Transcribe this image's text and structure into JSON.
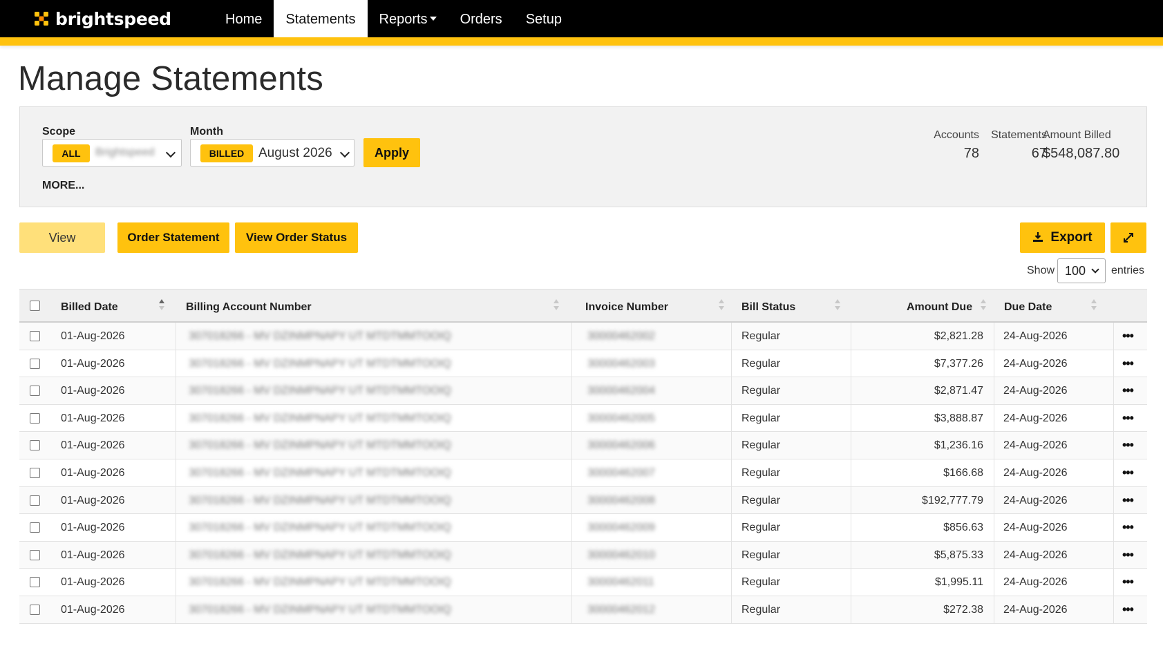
{
  "brand": {
    "name": "brightspeed",
    "accent": "#ffc20e"
  },
  "nav": {
    "items": [
      {
        "label": "Home",
        "active": false
      },
      {
        "label": "Statements",
        "active": true
      },
      {
        "label": "Reports",
        "active": false,
        "dropdown": true
      },
      {
        "label": "Orders",
        "active": false
      },
      {
        "label": "Setup",
        "active": false
      }
    ]
  },
  "page": {
    "title": "Manage Statements"
  },
  "filters": {
    "scope": {
      "label": "Scope",
      "pill": "ALL",
      "value": "Brightspeed"
    },
    "month": {
      "label": "Month",
      "pill": "BILLED",
      "value": "August 2026"
    },
    "apply_label": "Apply",
    "more_label": "MORE..."
  },
  "summary": {
    "accounts": {
      "label": "Accounts",
      "value": "78"
    },
    "statements": {
      "label": "Statements",
      "value": "67"
    },
    "amount_billed": {
      "label": "Amount Billed",
      "value": "$548,087.80"
    }
  },
  "actions": {
    "view_label": "View",
    "order_statement_label": "Order Statement",
    "view_order_status_label": "View Order Status",
    "export_label": "Export",
    "export_icon": "download-icon",
    "expand_icon": "expand-icon"
  },
  "pagination": {
    "show_label": "Show",
    "page_size": "100",
    "entries_label": "entries"
  },
  "table": {
    "columns": [
      "Billed Date",
      "Billing Account Number",
      "Invoice Number",
      "Bill Status",
      "Amount Due",
      "Due Date"
    ],
    "rows": [
      {
        "billed_date": "01-Aug-2026",
        "account": "307018266 - MV DZINMPNAPY UT MTDTMMTOOIQ",
        "invoice": "30000462002",
        "status": "Regular",
        "amount": "$2,821.28",
        "due_date": "24-Aug-2026"
      },
      {
        "billed_date": "01-Aug-2026",
        "account": "307018266 - MV DZINMPNAPY UT MTDTMMTOOIQ",
        "invoice": "30000462003",
        "status": "Regular",
        "amount": "$7,377.26",
        "due_date": "24-Aug-2026"
      },
      {
        "billed_date": "01-Aug-2026",
        "account": "307018266 - MV DZINMPNAPY UT MTDTMMTOOIQ",
        "invoice": "30000462004",
        "status": "Regular",
        "amount": "$2,871.47",
        "due_date": "24-Aug-2026"
      },
      {
        "billed_date": "01-Aug-2026",
        "account": "307018266 - MV DZINMPNAPY UT MTDTMMTOOIQ",
        "invoice": "30000462005",
        "status": "Regular",
        "amount": "$3,888.87",
        "due_date": "24-Aug-2026"
      },
      {
        "billed_date": "01-Aug-2026",
        "account": "307018266 - MV DZINMPNAPY UT MTDTMMTOOIQ",
        "invoice": "30000462006",
        "status": "Regular",
        "amount": "$1,236.16",
        "due_date": "24-Aug-2026"
      },
      {
        "billed_date": "01-Aug-2026",
        "account": "307018266 - MV DZINMPNAPY UT MTDTMMTOOIQ",
        "invoice": "30000462007",
        "status": "Regular",
        "amount": "$166.68",
        "due_date": "24-Aug-2026"
      },
      {
        "billed_date": "01-Aug-2026",
        "account": "307018266 - MV DZINMPNAPY UT MTDTMMTOOIQ",
        "invoice": "30000462008",
        "status": "Regular",
        "amount": "$192,777.79",
        "due_date": "24-Aug-2026"
      },
      {
        "billed_date": "01-Aug-2026",
        "account": "307018266 - MV DZINMPNAPY UT MTDTMMTOOIQ",
        "invoice": "30000462009",
        "status": "Regular",
        "amount": "$856.63",
        "due_date": "24-Aug-2026"
      },
      {
        "billed_date": "01-Aug-2026",
        "account": "307018266 - MV DZINMPNAPY UT MTDTMMTOOIQ",
        "invoice": "30000462010",
        "status": "Regular",
        "amount": "$5,875.33",
        "due_date": "24-Aug-2026"
      },
      {
        "billed_date": "01-Aug-2026",
        "account": "307018266 - MV DZINMPNAPY UT MTDTMMTOOIQ",
        "invoice": "30000462011",
        "status": "Regular",
        "amount": "$1,995.11",
        "due_date": "24-Aug-2026"
      },
      {
        "billed_date": "01-Aug-2026",
        "account": "307018266 - MV DZINMPNAPY UT MTDTMMTOOIQ",
        "invoice": "30000462012",
        "status": "Regular",
        "amount": "$272.38",
        "due_date": "24-Aug-2026"
      }
    ]
  }
}
